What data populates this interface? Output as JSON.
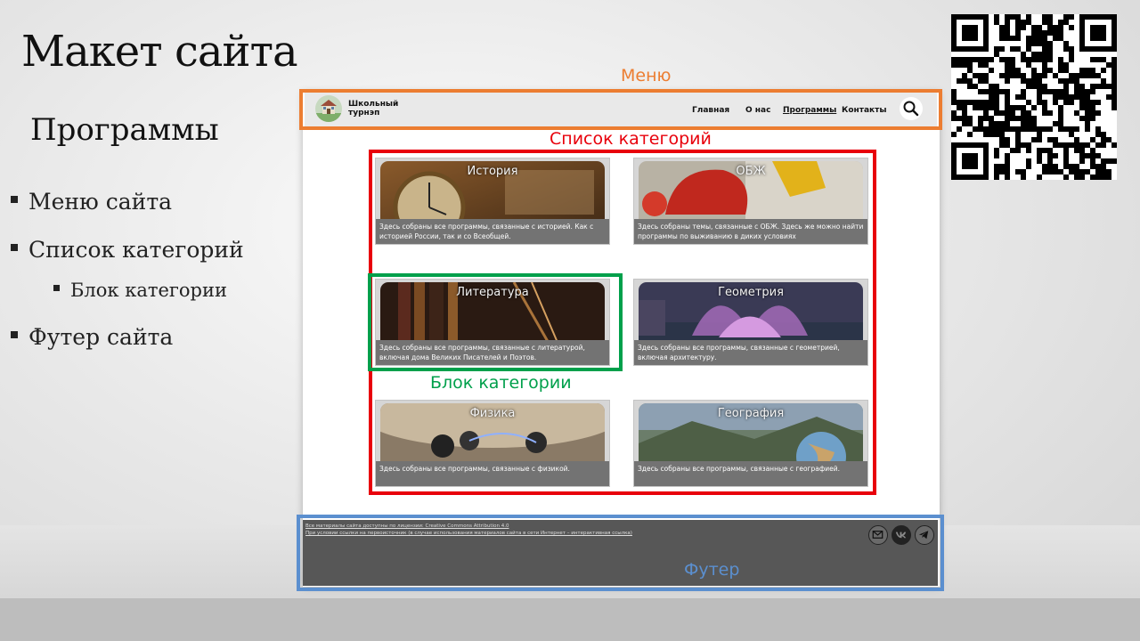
{
  "slide": {
    "title": "Макет сайта",
    "subtitle": "Программы",
    "bullets": [
      "Меню сайта",
      "Список категорий",
      "Блок категории",
      "Футер сайта"
    ]
  },
  "annotations": {
    "menu": "Меню",
    "categories_list": "Список категорий",
    "category_block": "Блок категории",
    "footer": "Футер"
  },
  "site": {
    "logo_text": "Школьный турнэп",
    "nav": [
      "Главная",
      "О нас",
      "Программы",
      "Контакты"
    ],
    "active_nav": "Программы",
    "categories": [
      {
        "title": "История",
        "description": "Здесь собраны все программы, связанные с историей. Как с историей России, так и со Всеобщей."
      },
      {
        "title": "ОБЖ",
        "description": "Здесь собраны темы, связанные с ОБЖ. Здесь же можно найти программы по выживанию в диких условиях"
      },
      {
        "title": "Литература",
        "description": "Здесь собраны все программы, связанные с литературой, включая дома Великих Писателей и Поэтов."
      },
      {
        "title": "Геометрия",
        "description": "Здесь собраны все программы, связанные с геометрией, включая архитектуру."
      },
      {
        "title": "Физика",
        "description": "Здесь собраны все программы, связанные с физикой."
      },
      {
        "title": "География",
        "description": "Здесь собраны все программы, связанные с географией."
      }
    ],
    "footer": {
      "line1": "Все материалы сайта доступны по лицензии: Creative Commons Attribution 4.0",
      "line2": "При условии ссылки на первоисточник (в случае использования материалов сайта в сети Интернет – интерактивная ссылка)",
      "social_icons": [
        "mail-icon",
        "vk-icon",
        "telegram-icon"
      ]
    }
  },
  "colors": {
    "menu_annotation": "#ec7d31",
    "categories_annotation": "#e8000b",
    "block_annotation": "#00a04b",
    "footer_annotation": "#5b8fcf"
  }
}
